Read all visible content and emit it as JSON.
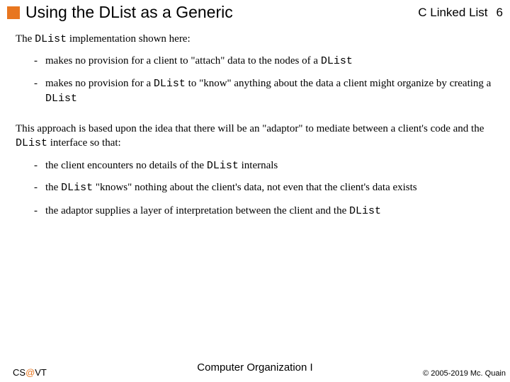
{
  "header": {
    "title": "Using the DList as a Generic",
    "right": "C Linked List",
    "page": "6"
  },
  "body": {
    "intro_pre": "The ",
    "intro_code": "DList",
    "intro_post": " implementation shown here:",
    "l1": {
      "a_pre": "makes no provision for a client to \"attach\" data to the nodes of a ",
      "a_code": "DList",
      "b_pre": "makes no provision for a ",
      "b_code": "DList",
      "b_post": " to \"know\" anything about the data a client might organize by creating a ",
      "b_code2": "DList"
    },
    "mid_pre": "This approach is based upon the idea that there will be an \"adaptor\" to mediate between a client's code and the ",
    "mid_code": "DList",
    "mid_post": " interface so that:",
    "l2": {
      "a_pre": "the client encounters no details of the ",
      "a_code": "DList",
      "a_post": " internals",
      "b_pre": "the ",
      "b_code": "DList",
      "b_post": " \"knows\" nothing about the client's data, not even that the client's data exists",
      "c_pre": "the adaptor supplies a layer of interpretation between the client and the ",
      "c_code": "DList"
    }
  },
  "footer": {
    "left_pre": "CS",
    "left_at": "@",
    "left_post": "VT",
    "center": "Computer Organization I",
    "right": "© 2005-2019 Mc. Quain"
  }
}
